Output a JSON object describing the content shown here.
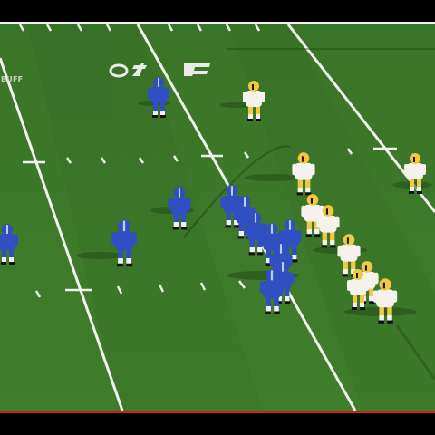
{
  "scene": {
    "watermark_text": "BUFF",
    "yard_number_text": "O",
    "colors": {
      "field_green": "#3f7a2c",
      "field_green_dark": "#356b24",
      "yard_line_white": "#f2f2ee",
      "blue_team": "#2f4fc2",
      "blue_team_dark": "#1f3690",
      "gold_team": "#f0c843",
      "white_jersey": "#f4f2ea",
      "broadcast_bar_red": "#c8201a"
    },
    "teams": {
      "offense": "blue-uniform-team",
      "defense": "white-gold-uniform-team"
    }
  }
}
